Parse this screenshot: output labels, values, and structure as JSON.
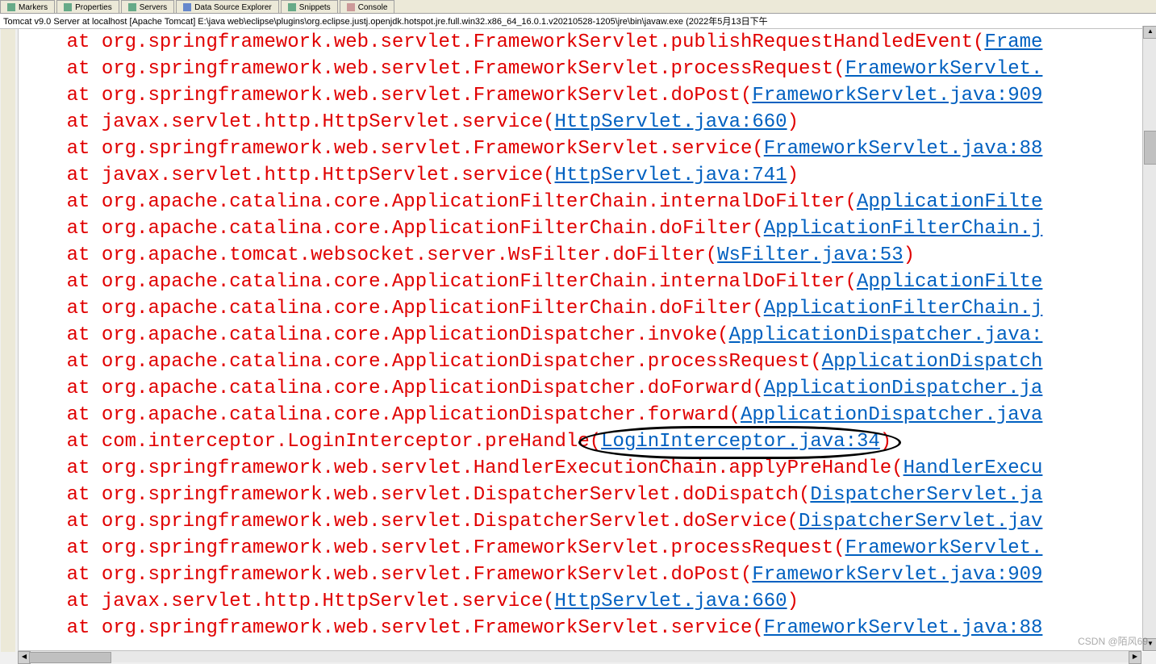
{
  "tabs": [
    {
      "label": "Markers",
      "icon": "generic"
    },
    {
      "label": "Properties",
      "icon": "generic"
    },
    {
      "label": "Servers",
      "icon": "generic"
    },
    {
      "label": "Data Source Explorer",
      "icon": "db"
    },
    {
      "label": "Snippets",
      "icon": "generic"
    },
    {
      "label": "Console",
      "icon": "console"
    }
  ],
  "status_line": "Tomcat v9.0 Server at localhost [Apache Tomcat] E:\\java web\\eclipse\\plugins\\org.eclipse.justj.openjdk.hotspot.jre.full.win32.x86_64_16.0.1.v20210528-1205\\jre\\bin\\javaw.exe  (2022年5月13日下午",
  "stack": [
    {
      "at": "    at ",
      "cls": "org.springframework.web.servlet.FrameworkServlet.publishRequestHandledEvent",
      "link": "Frame"
    },
    {
      "at": "    at ",
      "cls": "org.springframework.web.servlet.FrameworkServlet.processRequest",
      "link": "FrameworkServlet."
    },
    {
      "at": "    at ",
      "cls": "org.springframework.web.servlet.FrameworkServlet.doPost",
      "link": "FrameworkServlet.java:909"
    },
    {
      "at": "    at ",
      "cls": "javax.servlet.http.HttpServlet.service",
      "link": "HttpServlet.java:660",
      "closed": true
    },
    {
      "at": "    at ",
      "cls": "org.springframework.web.servlet.FrameworkServlet.service",
      "link": "FrameworkServlet.java:88"
    },
    {
      "at": "    at ",
      "cls": "javax.servlet.http.HttpServlet.service",
      "link": "HttpServlet.java:741",
      "closed": true
    },
    {
      "at": "    at ",
      "cls": "org.apache.catalina.core.ApplicationFilterChain.internalDoFilter",
      "link": "ApplicationFilte"
    },
    {
      "at": "    at ",
      "cls": "org.apache.catalina.core.ApplicationFilterChain.doFilter",
      "link": "ApplicationFilterChain.j"
    },
    {
      "at": "    at ",
      "cls": "org.apache.tomcat.websocket.server.WsFilter.doFilter",
      "link": "WsFilter.java:53",
      "closed": true
    },
    {
      "at": "    at ",
      "cls": "org.apache.catalina.core.ApplicationFilterChain.internalDoFilter",
      "link": "ApplicationFilte"
    },
    {
      "at": "    at ",
      "cls": "org.apache.catalina.core.ApplicationFilterChain.doFilter",
      "link": "ApplicationFilterChain.j"
    },
    {
      "at": "    at ",
      "cls": "org.apache.catalina.core.ApplicationDispatcher.invoke",
      "link": "ApplicationDispatcher.java:"
    },
    {
      "at": "    at ",
      "cls": "org.apache.catalina.core.ApplicationDispatcher.processRequest",
      "link": "ApplicationDispatch"
    },
    {
      "at": "    at ",
      "cls": "org.apache.catalina.core.ApplicationDispatcher.doForward",
      "link": "ApplicationDispatcher.ja"
    },
    {
      "at": "    at ",
      "cls": "org.apache.catalina.core.ApplicationDispatcher.forward",
      "link": "ApplicationDispatcher.java"
    },
    {
      "at": "    at ",
      "cls": "com.interceptor.LoginInterceptor.preHandle",
      "link": "LoginInterceptor.java:34",
      "closed": true,
      "highlight": true
    },
    {
      "at": "    at ",
      "cls": "org.springframework.web.servlet.HandlerExecutionChain.applyPreHandle",
      "link": "HandlerExecu"
    },
    {
      "at": "    at ",
      "cls": "org.springframework.web.servlet.DispatcherServlet.doDispatch",
      "link": "DispatcherServlet.ja"
    },
    {
      "at": "    at ",
      "cls": "org.springframework.web.servlet.DispatcherServlet.doService",
      "link": "DispatcherServlet.jav"
    },
    {
      "at": "    at ",
      "cls": "org.springframework.web.servlet.FrameworkServlet.processRequest",
      "link": "FrameworkServlet."
    },
    {
      "at": "    at ",
      "cls": "org.springframework.web.servlet.FrameworkServlet.doPost",
      "link": "FrameworkServlet.java:909"
    },
    {
      "at": "    at ",
      "cls": "javax.servlet.http.HttpServlet.service",
      "link": "HttpServlet.java:660",
      "closed": true
    },
    {
      "at": "    at ",
      "cls": "org.springframework.web.servlet.FrameworkServlet.service",
      "link": "FrameworkServlet.java:88"
    }
  ],
  "watermark": "CSDN @陌风69"
}
